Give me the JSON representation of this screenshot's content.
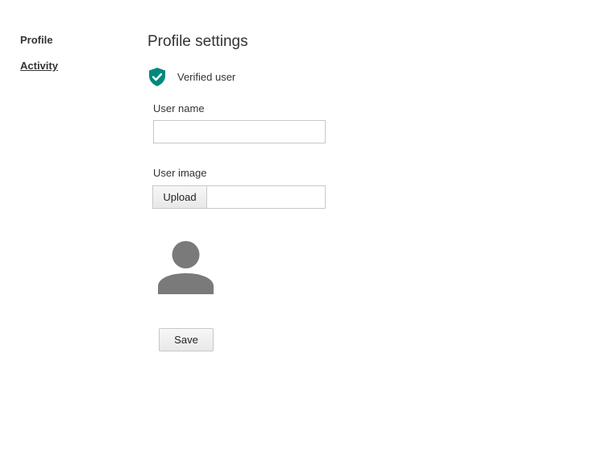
{
  "sidebar": {
    "items": [
      {
        "label": "Profile"
      },
      {
        "label": "Activity"
      }
    ]
  },
  "main": {
    "title": "Profile settings",
    "verified": {
      "label": "Verified user",
      "icon": "shield-check-icon",
      "color": "#00897b"
    },
    "username": {
      "label": "User name",
      "value": "",
      "placeholder": ""
    },
    "user_image": {
      "label": "User image",
      "upload_label": "Upload"
    },
    "avatar": {
      "icon": "user-silhouette-icon",
      "color": "#7a7a7a"
    },
    "save_label": "Save"
  }
}
